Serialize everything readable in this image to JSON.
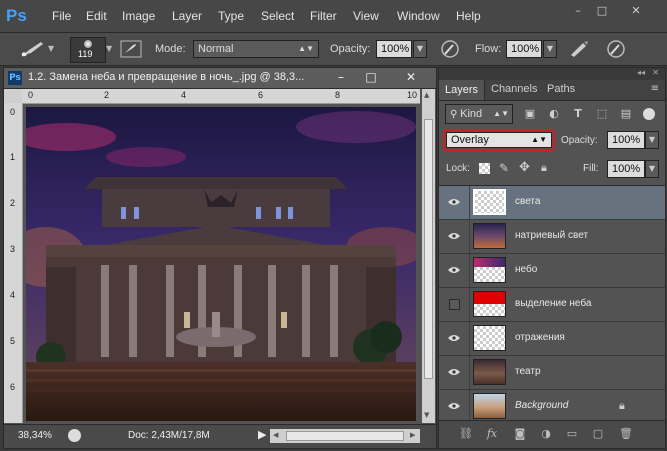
{
  "app": {
    "logo": "Ps"
  },
  "menu": [
    "File",
    "Edit",
    "Image",
    "Layer",
    "Type",
    "Select",
    "Filter",
    "View",
    "Window",
    "Help"
  ],
  "window_controls": {
    "minimize": "–",
    "restore": "□",
    "close": "✕"
  },
  "options": {
    "brush_size": "119",
    "mode_label": "Mode:",
    "mode_value": "Normal",
    "opacity_label": "Opacity:",
    "opacity_value": "100%",
    "flow_label": "Flow:",
    "flow_value": "100%"
  },
  "document": {
    "title": "1.2. Замена неба и превращение в ночь_.jpg @ 38,3...",
    "zoom": "38,34%",
    "doc_info": "Doc: 2,43M/17,8M",
    "ruler_h": [
      "0",
      "2",
      "4",
      "6",
      "8",
      "10"
    ],
    "ruler_v": [
      "0",
      "1",
      "2",
      "3",
      "4",
      "5",
      "6"
    ]
  },
  "panel": {
    "tabs": [
      "Layers",
      "Channels",
      "Paths"
    ],
    "kind_label": "Kind",
    "blend_mode": "Overlay",
    "opacity_label": "Opacity:",
    "opacity_value": "100%",
    "lock_label": "Lock:",
    "fill_label": "Fill:",
    "fill_value": "100%",
    "layers": [
      {
        "name": "света",
        "visible": true,
        "selected": true,
        "italic": false
      },
      {
        "name": "натриевый свет",
        "visible": true,
        "selected": false,
        "italic": false
      },
      {
        "name": "небо",
        "visible": true,
        "selected": false,
        "italic": false
      },
      {
        "name": "выделение неба",
        "visible": false,
        "selected": false,
        "italic": false
      },
      {
        "name": "отражения",
        "visible": true,
        "selected": false,
        "italic": false
      },
      {
        "name": "театр",
        "visible": true,
        "selected": false,
        "italic": false
      },
      {
        "name": "Background",
        "visible": true,
        "selected": false,
        "italic": true
      }
    ]
  },
  "colors": {
    "accent": "#3fa2ff",
    "highlight_outline": "#d11f1f",
    "selected_layer": "#66737f"
  }
}
